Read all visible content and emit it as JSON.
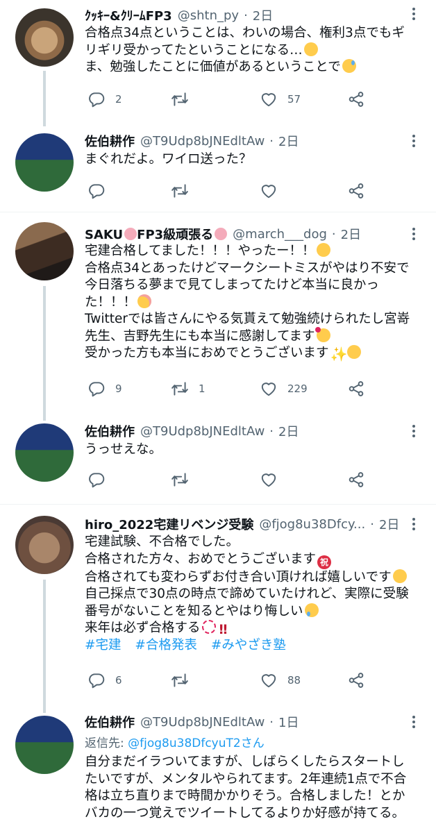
{
  "tweets": [
    {
      "name": "ｸｯｷｰ&ｸﾘｰﾑFP3",
      "handle": "@shtn_py",
      "time": "2日",
      "lines": [
        "合格点34点ということは、わいの場合、権利3点でもギ",
        "リギリ受かってたということになる…",
        "ま、勉強したことに価値があるということで"
      ],
      "replies": "2",
      "retweets": "",
      "likes": "57"
    },
    {
      "name": "佐伯耕作",
      "handle": "@T9Udp8bJNEdltAw",
      "time": "2日",
      "lines": [
        "まぐれだよ。ワイロ送った？"
      ],
      "replies": "",
      "retweets": "",
      "likes": ""
    },
    {
      "name_parts": [
        "SAKU",
        "FP3級頑張る"
      ],
      "handle": "@march___dog",
      "time": "2日",
      "lines": [
        "宅建合格してました！！！やったー！！",
        "合格点34とあったけどマークシートミスがやはり不安で",
        "今日落ちる夢まで見てしまってたけど本当に良かっ",
        "た！！！",
        "Twitterでは皆さんにやる気貰えて勉強続けられたし宮嵜",
        "先生、吉野先生にも本当に感謝してます",
        "受かった方も本当におめでとうございます"
      ],
      "replies": "9",
      "retweets": "1",
      "likes": "229"
    },
    {
      "name": "佐伯耕作",
      "handle": "@T9Udp8bJNEdltAw",
      "time": "2日",
      "lines": [
        "うっせえな。"
      ],
      "replies": "",
      "retweets": "",
      "likes": ""
    },
    {
      "name": "hiro_2022宅建リベンジ受験",
      "handle": "@fjog8u38Dfcy...",
      "time": "2日",
      "lines": [
        "宅建試験、不合格でした。",
        "合格された方々、おめでとうございます",
        "合格されても変わらずお付き合い頂ければ嬉しいです",
        "自己採点で30点の時点で諦めていたけれど、実際に受験",
        "番号がないことを知るとやはり悔しい",
        "来年は必ず合格する"
      ],
      "hashtags": [
        "#宅建",
        "#合格発表",
        "#みやざき塾"
      ],
      "replies": "6",
      "retweets": "",
      "likes": "88"
    },
    {
      "name": "佐伯耕作",
      "handle": "@T9Udp8bJNEdltAw",
      "time": "1日",
      "reply_label": "返信先: ",
      "reply_mention": "@fjog8u38DfcyuT2さん",
      "lines": [
        "自分まだイラついてますが、しばらくしたらスタートし",
        "たいですが、メンタルやられてます。2年連続1点で不合",
        "格は立ち直りまで時間かかりそう。合格しました！とか",
        "バカの一つ覚えでツイートしてるよりか好感が持てる。"
      ],
      "replies": "",
      "retweets": "",
      "likes": ""
    }
  ],
  "ui": {
    "dot": "·",
    "iwai": "祝",
    "sparkle": "✨",
    "bang": "‼"
  },
  "colors": {
    "link": "#1d9bf0",
    "secondary_text": "#536471",
    "thread_line": "#cfd9de",
    "divider": "#eff3f4"
  },
  "icons": [
    "reply-icon",
    "retweet-icon",
    "like-icon",
    "share-icon",
    "more-icon"
  ]
}
